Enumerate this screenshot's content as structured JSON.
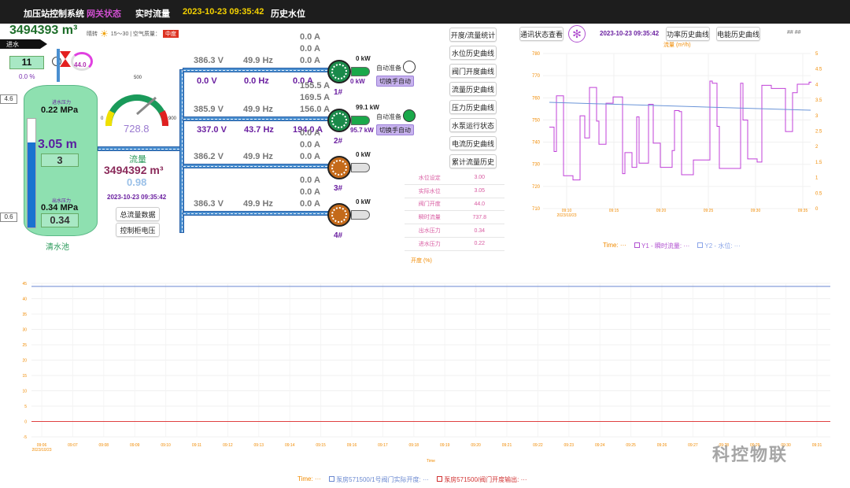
{
  "nav": {
    "system": "加压站控制系统",
    "gateway": "网关状态",
    "realtime": "实时流量",
    "datetime": "2023-10-23 09:35:42",
    "history_level": "历史水位"
  },
  "totals": {
    "top_flow": "3494393 m³",
    "inflow_label": "进水",
    "clear_pool_label": "清水池"
  },
  "weather": {
    "label": "晴转",
    "range": "15～30 | 空气质量：",
    "aqi": "中度"
  },
  "inlet": {
    "value": "11",
    "percent": "0.0 %",
    "gauge": "44.0"
  },
  "tank": {
    "in_pressure_label": "进水压力",
    "in_pressure": "0.22 MPa",
    "level": "3.05 m",
    "level_box": "3",
    "out_pressure_label": "出水压力",
    "out_pressure": "0.34 MPa",
    "out_box": "0.34",
    "scale_top": "4.6",
    "scale_bottom": "0.6"
  },
  "gauge": {
    "max": "500",
    "min": "0",
    "right": "900",
    "value": "728.8",
    "flow_label": "流量",
    "total": "3494392 m³",
    "sub": "0.98",
    "time": "2023-10-23 09:35:42",
    "btn_total": "总流量数据",
    "btn_voltage": "控制柜电压"
  },
  "pumps": [
    {
      "id": "1#",
      "v": "386.3 V",
      "hz": "49.9 Hz",
      "ia": "0.0 A",
      "ib": "0.0 A",
      "ic": "0.0 A",
      "v2": "0.0 V",
      "hz2": "0.0 Hz",
      "ia2": "0.0 A",
      "kw": "0 kW",
      "kw2": "0 kW",
      "auto": "自动准备",
      "switch": "切换手自动",
      "color": "#1aa84a"
    },
    {
      "id": "2#",
      "v": "385.9 V",
      "hz": "49.9 Hz",
      "ia": "155.5 A",
      "ib": "169.5 A",
      "ic": "156.0 A",
      "v2": "337.0 V",
      "hz2": "43.7 Hz",
      "ia2": "194.0 A",
      "kw": "99.1 kW",
      "kw2": "95.7 kW",
      "auto": "自动准备",
      "switch": "切换手自动",
      "color": "#1aa84a"
    },
    {
      "id": "3#",
      "v": "386.2 V",
      "hz": "49.9 Hz",
      "ia": "0.0 A",
      "ib": "0.0 A",
      "ic": "0.0 A",
      "kw": "0 kW",
      "color": "#e0e0e0"
    },
    {
      "id": "4#",
      "v": "386.3 V",
      "hz": "49.9 Hz",
      "ia": "0.0 A",
      "ib": "0.0 A",
      "ic": "0.0 A",
      "kw": "0 kW",
      "color": "#e0e0e0"
    }
  ],
  "menu": [
    "开度/流量统计",
    "水位历史曲线",
    "阀门开度曲线",
    "流量历史曲线",
    "压力历史曲线",
    "水泵运行状态",
    "电流历史曲线",
    "累计流量历史"
  ],
  "right_top": {
    "comm": "通讯状态查看",
    "time": "2023-10-23 09:35:42",
    "power": "功率历史曲线",
    "energy": "电能历史曲线",
    "hash": "## ##"
  },
  "status_table": [
    [
      "水位设定",
      "3.00"
    ],
    [
      "实际水位",
      "3.05"
    ],
    [
      "阀门开度",
      "44.0"
    ],
    [
      "瞬时流量",
      "737.8"
    ],
    [
      "出水压力",
      "0.34"
    ],
    [
      "进水压力",
      "0.22"
    ]
  ],
  "opening_label": "开度 (%)",
  "chart_top": {
    "title": "流量 (m³/h)",
    "legend_time": "Time: ···",
    "legend_y1": "Y1 - 瞬时流量: ···",
    "legend_y2": "Y2 - 水位: ···",
    "x_ticks": [
      "09:10",
      "09:15",
      "09:20",
      "09:25",
      "09:30",
      "09:35"
    ],
    "x_sub": "2023/10/23",
    "y_left": [
      "780",
      "770",
      "760",
      "750",
      "740",
      "730",
      "720",
      "710"
    ],
    "y_right": [
      "5",
      "4.5",
      "4",
      "3.5",
      "3",
      "2.5",
      "2",
      "1.5",
      "1",
      "0.5",
      "0"
    ]
  },
  "chart_bottom": {
    "legend_time": "Time: ···",
    "legend_a": "泵房571500/1号阀门实际开度: ···",
    "legend_b": "泵房571500/阀门开度输出: ···",
    "x_label": "Time",
    "x_sub": "2023/10/23",
    "y_ticks": [
      "45",
      "40",
      "35",
      "30",
      "25",
      "20",
      "15",
      "10",
      "5",
      "0",
      "-5"
    ],
    "x_ticks": [
      "09:06",
      "09:07",
      "09:08",
      "09:09",
      "09:10",
      "09:11",
      "09:12",
      "09:13",
      "09:14",
      "09:15",
      "09:16",
      "09:17",
      "09:18",
      "09:19",
      "09:20",
      "09:21",
      "09:22",
      "09:23",
      "09:24",
      "09:25",
      "09:26",
      "09:27",
      "09:28",
      "09:29",
      "09:30",
      "09:31"
    ]
  },
  "watermark": "科控物联"
}
